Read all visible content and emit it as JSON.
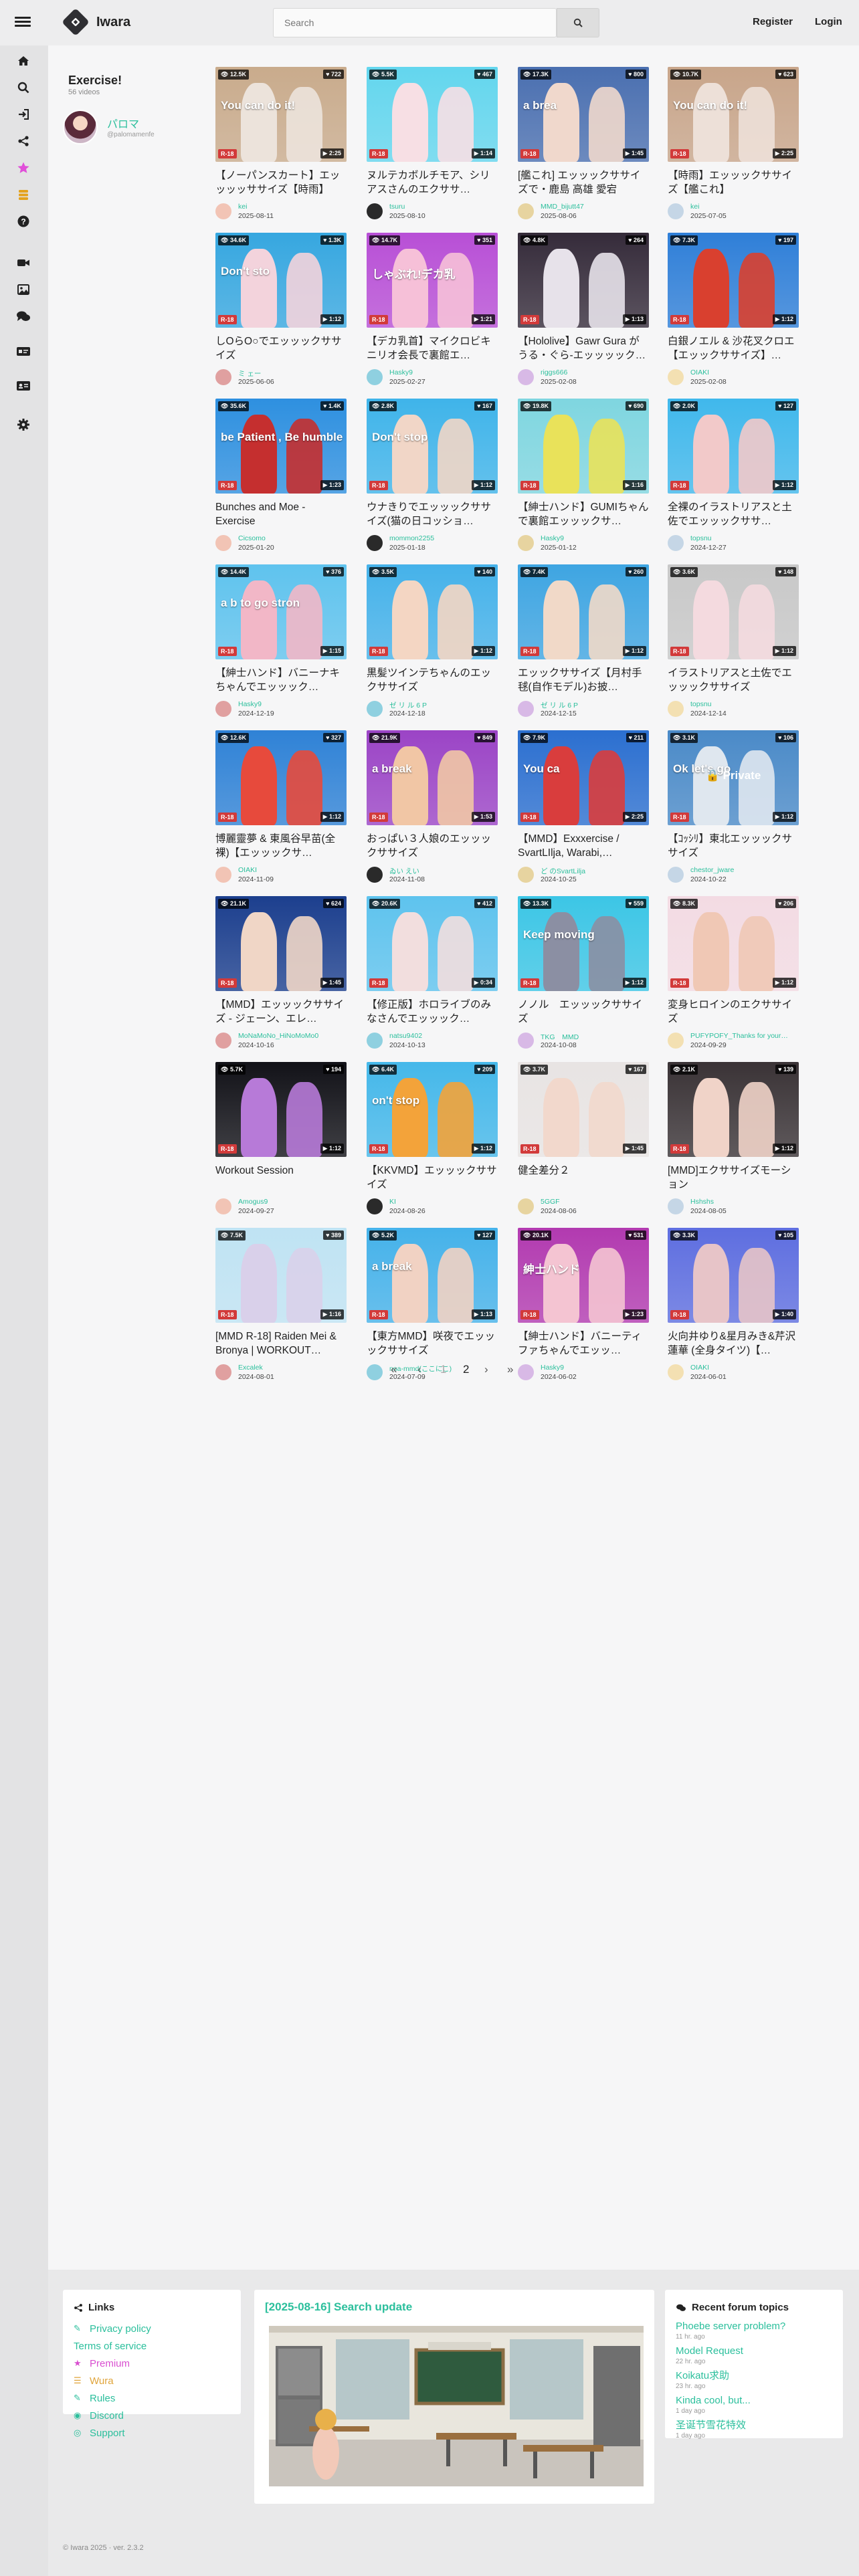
{
  "header": {
    "brand": "Iwara",
    "search_placeholder": "Search",
    "register": "Register",
    "login": "Login"
  },
  "sidebar_icons": [
    "home-icon",
    "search-icon",
    "sign-in-icon",
    "share-icon",
    "star-icon",
    "coins-icon",
    "help-icon",
    "video-icon",
    "image-icon",
    "forum-icon",
    "id-card-icon",
    "profile-card-icon",
    "gear-icon"
  ],
  "playlist": {
    "title": "Exercise!",
    "count": "56 videos",
    "owner_name": "パロマ",
    "owner_handle": "@palomamenfe"
  },
  "videos": [
    {
      "views": "12.5K",
      "likes": "722",
      "dur": "2:25",
      "title": "【ノーパンスカート】エッッッッササイズ【時雨】",
      "user": "kei",
      "date": "2025-08-11",
      "bg": "#c9ab8c",
      "fg": "#ece3db",
      "overlay": "You can do it!"
    },
    {
      "views": "5.5K",
      "likes": "467",
      "dur": "1:14",
      "title": "ヌルテカボルチモア、シリアスさんのエクササ…",
      "user": "tsuru",
      "date": "2025-08-10",
      "bg": "#63d6ee",
      "fg": "#f7dfe4",
      "overlay": ""
    },
    {
      "views": "17.3K",
      "likes": "800",
      "dur": "1:45",
      "title": "[艦これ] エッッックササイズで・鹿島 高雄 愛宕",
      "user": "MMD_bijutt47",
      "date": "2025-08-06",
      "bg": "#4a6fb0",
      "fg": "#f0d8cc",
      "overlay": "a brea"
    },
    {
      "views": "10.7K",
      "likes": "623",
      "dur": "2:25",
      "title": "【時雨】エッッックササイズ【艦これ】",
      "user": "kei",
      "date": "2025-07-05",
      "bg": "#c8a58a",
      "fg": "#ede0d8",
      "overlay": "You can do it!"
    },
    {
      "views": "34.6K",
      "likes": "1.3K",
      "dur": "1:12",
      "title": "しOらO○でエッッックササイズ",
      "user": "ミ ェー",
      "date": "2025-06-06",
      "bg": "#36a7e0",
      "fg": "#f3d3dc",
      "overlay": "Don't sto"
    },
    {
      "views": "14.7K",
      "likes": "351",
      "dur": "1:21",
      "title": "【デカ乳首】マイクロビキニリオ会長で裏館エ…",
      "user": "Hasky9",
      "date": "2025-02-27",
      "bg": "#b84fd6",
      "fg": "#f6c0d8",
      "overlay": "しゃぶれ!デカ乳"
    },
    {
      "views": "4.8K",
      "likes": "264",
      "dur": "1:13",
      "title": "【Hololive】Gawr Gura がうる・ぐら-エッッッック…",
      "user": "riggs666",
      "date": "2025-02-08",
      "bg": "#352b3a",
      "fg": "#e7e2ea",
      "overlay": ""
    },
    {
      "views": "7.3K",
      "likes": "197",
      "dur": "1:12",
      "title": "白銀ノエル & 沙花叉クロエ 【エッックササイズ】…",
      "user": "OIAKI",
      "date": "2025-02-08",
      "bg": "#2f7fd8",
      "fg": "#d9402f",
      "overlay": ""
    },
    {
      "views": "35.6K",
      "likes": "1.4K",
      "dur": "1:23",
      "title": "Bunches and Moe - Exercise",
      "user": "Cicsomo",
      "date": "2025-01-20",
      "bg": "#2e90e0",
      "fg": "#c52f2f",
      "overlay": "be Patient , Be humble"
    },
    {
      "views": "2.8K",
      "likes": "167",
      "dur": "1:12",
      "title": "ウナきりでエッッックササイズ(猫の日コッショ…",
      "user": "mommon2255",
      "date": "2025-01-18",
      "bg": "#3fb4ea",
      "fg": "#f1d6c7",
      "overlay": "Don't stop"
    },
    {
      "views": "19.8K",
      "likes": "690",
      "dur": "1:16",
      "title": "【紳士ハンド】GUMIちゃんで裏館エッッックサ…",
      "user": "Hasky9",
      "date": "2025-01-12",
      "bg": "#7fd6e0",
      "fg": "#e9e25a",
      "overlay": ""
    },
    {
      "views": "2.0K",
      "likes": "127",
      "dur": "1:12",
      "title": "全裸のイラストリアスと土佐でエッッックササ…",
      "user": "topsnu",
      "date": "2024-12-27",
      "bg": "#40b8ec",
      "fg": "#f2c9c9",
      "overlay": ""
    },
    {
      "views": "14.4K",
      "likes": "376",
      "dur": "1:15",
      "title": "【紳士ハンド】バニーナキちゃんでエッッック…",
      "user": "Hasky9",
      "date": "2024-12-19",
      "bg": "#5fc3ee",
      "fg": "#f2b7c7",
      "overlay": "a b\nto go stron"
    },
    {
      "views": "3.5K",
      "likes": "140",
      "dur": "1:12",
      "title": "黒髪ツインテちゃんのエックササイズ",
      "user": "ゼ リ ル 6 P",
      "date": "2024-12-18",
      "bg": "#45b2ea",
      "fg": "#f4d6c3",
      "overlay": ""
    },
    {
      "views": "7.4K",
      "likes": "260",
      "dur": "1:12",
      "title": "エッックササイズ【月村手毬(自作モデル)お披…",
      "user": "ゼ リ ル 6 P",
      "date": "2024-12-15",
      "bg": "#3ea5e2",
      "fg": "#f1d9c8",
      "overlay": ""
    },
    {
      "views": "3.6K",
      "likes": "148",
      "dur": "1:12",
      "title": "イラストリアスと土佐でエッッックササイズ",
      "user": "topsnu",
      "date": "2024-12-14",
      "bg": "#c8c8c8",
      "fg": "#f4dadf",
      "overlay": ""
    },
    {
      "views": "12.6K",
      "likes": "327",
      "dur": "1:12",
      "title": "博麗靈夢 & 東風谷早苗(全裸)【エッッックサ…",
      "user": "OIAKI",
      "date": "2024-11-09",
      "bg": "#2f82d6",
      "fg": "#e74a3c",
      "overlay": ""
    },
    {
      "views": "21.9K",
      "likes": "849",
      "dur": "1:53",
      "title": "おっぱい３人娘のエッッックササイズ",
      "user": "ゐい えい",
      "date": "2024-11-08",
      "bg": "#9b44c6",
      "fg": "#f1c6a5",
      "overlay": "a break"
    },
    {
      "views": "7.9K",
      "likes": "211",
      "dur": "2:25",
      "title": "【MMD】Exxxercise / SvartLIlja, Warabi,…",
      "user": "ど のSvartLilja",
      "date": "2024-10-25",
      "bg": "#2b6fd0",
      "fg": "#d93d3d",
      "overlay": "You ca"
    },
    {
      "views": "3.1K",
      "likes": "106",
      "dur": "1:12",
      "title": "【ｺｯｼﾘ】東北エッッックササイズ",
      "user": "chestor_jware",
      "date": "2024-10-22",
      "bg": "#4a8ac8",
      "fg": "#dfe7ef",
      "overlay": "Ok let's go",
      "private": "Private"
    },
    {
      "views": "21.1K",
      "likes": "624",
      "dur": "1:45",
      "title": "【MMD】エッッックササイズ - ジェーン、エレ…",
      "user": "MoNaMoNo_HiNoMoMo0",
      "date": "2024-10-16",
      "bg": "#1c3f8e",
      "fg": "#f0d6c6",
      "overlay": ""
    },
    {
      "views": "20.6K",
      "likes": "412",
      "dur": "0:34",
      "title": "【修正版】ホロライブのみなさんでエッッック…",
      "user": "natsu9402",
      "date": "2024-10-13",
      "bg": "#5ec3ee",
      "fg": "#f2dede",
      "overlay": ""
    },
    {
      "views": "13.3K",
      "likes": "559",
      "dur": "1:12",
      "title": "ノノル　エッッックササイズ",
      "user": "TKG　MMD",
      "date": "2024-10-08",
      "bg": "#3cc6e6",
      "fg": "#8b8fa3",
      "overlay": "Keep moving"
    },
    {
      "views": "8.3K",
      "likes": "206",
      "dur": "1:12",
      "title": "変身ヒロインのエクササイズ",
      "user": "PUFYPOFY_Thanks for your…",
      "date": "2024-09-29",
      "bg": "#f3dbe3",
      "fg": "#f0c8b5",
      "overlay": ""
    },
    {
      "views": "5.7K",
      "likes": "194",
      "dur": "1:12",
      "title": "Workout Session",
      "user": "Amogus9",
      "date": "2024-09-27",
      "bg": "#121218",
      "fg": "#b77ad8",
      "overlay": ""
    },
    {
      "views": "6.4K",
      "likes": "209",
      "dur": "1:12",
      "title": "【KKVMD】エッッックササイズ",
      "user": "KI",
      "date": "2024-08-26",
      "bg": "#45b8ea",
      "fg": "#f3a33a",
      "overlay": "on't stop"
    },
    {
      "views": "3.7K",
      "likes": "167",
      "dur": "1:45",
      "title": "健全差分２",
      "user": "5GGF",
      "date": "2024-08-06",
      "bg": "#e8e4e3",
      "fg": "#f2d8cc",
      "overlay": ""
    },
    {
      "views": "2.1K",
      "likes": "139",
      "dur": "1:12",
      "title": "[MMD]エクササイズモーション",
      "user": "Hshshs",
      "date": "2024-08-05",
      "bg": "#3a3336",
      "fg": "#f0d3c8",
      "overlay": ""
    },
    {
      "views": "7.5K",
      "likes": "389",
      "dur": "1:16",
      "title": "[MMD R-18] Raiden Mei & Bronya | WORKOUT…",
      "user": "Excalek",
      "date": "2024-08-01",
      "bg": "#bfe3f3",
      "fg": "#d9d0ea",
      "overlay": ""
    },
    {
      "views": "5.2K",
      "likes": "127",
      "dur": "1:13",
      "title": "【東方MMD】咲夜でエッッックササイズ",
      "user": "noa-mmd(ここにこ)",
      "date": "2024-07-09",
      "bg": "#45b2ea",
      "fg": "#f1d2c3",
      "overlay": "a break"
    },
    {
      "views": "20.1K",
      "likes": "531",
      "dur": "1:23",
      "title": "【紳士ハンド】バニーティファちゃんでエッッ…",
      "user": "Hasky9",
      "date": "2024-06-02",
      "bg": "#b23ab0",
      "fg": "#f4c4d2",
      "overlay": "紳士ハンド"
    },
    {
      "views": "3.3K",
      "likes": "105",
      "dur": "1:40",
      "title": "火向井ゆり&星月みき&芹沢蓮華 (全身タイツ)【…",
      "user": "OIAKI",
      "date": "2024-06-01",
      "bg": "#5e6ee0",
      "fg": "#e7c4c8",
      "overlay": ""
    }
  ],
  "pagination": {
    "first": "«",
    "prev": "‹",
    "pages": [
      "1",
      "2"
    ],
    "next": "›",
    "last": "»"
  },
  "footer": {
    "links_title": "Links",
    "links": [
      {
        "icon": "✎",
        "label": "Privacy policy",
        "color": "#2bbf9c"
      },
      {
        "icon": "",
        "label": "Terms of service",
        "color": "#2bbf9c"
      },
      {
        "icon": "★",
        "label": "Premium",
        "color": "#d94fd0"
      },
      {
        "icon": "☰",
        "label": "Wura",
        "color": "#e0a43a"
      },
      {
        "icon": "✎",
        "label": "Rules",
        "color": "#2bbf9c"
      },
      {
        "icon": "◉",
        "label": "Discord",
        "color": "#2bbf9c"
      },
      {
        "icon": "◎",
        "label": "Support",
        "color": "#2bbf9c"
      }
    ],
    "news_title": "[2025-08-16] Search update",
    "forum_title": "Recent forum topics",
    "topics": [
      {
        "title": "Phoebe server problem?",
        "ago": "11 hr. ago"
      },
      {
        "title": "Model Request",
        "ago": "22 hr. ago"
      },
      {
        "title": "Koikatu求助",
        "ago": "23 hr. ago"
      },
      {
        "title": "Kinda cool, but...",
        "ago": "1 day ago"
      },
      {
        "title": "圣诞节雪花特效",
        "ago": "1 day ago"
      }
    ],
    "copyright": "© Iwara 2025 · ver. 2.3.2"
  }
}
